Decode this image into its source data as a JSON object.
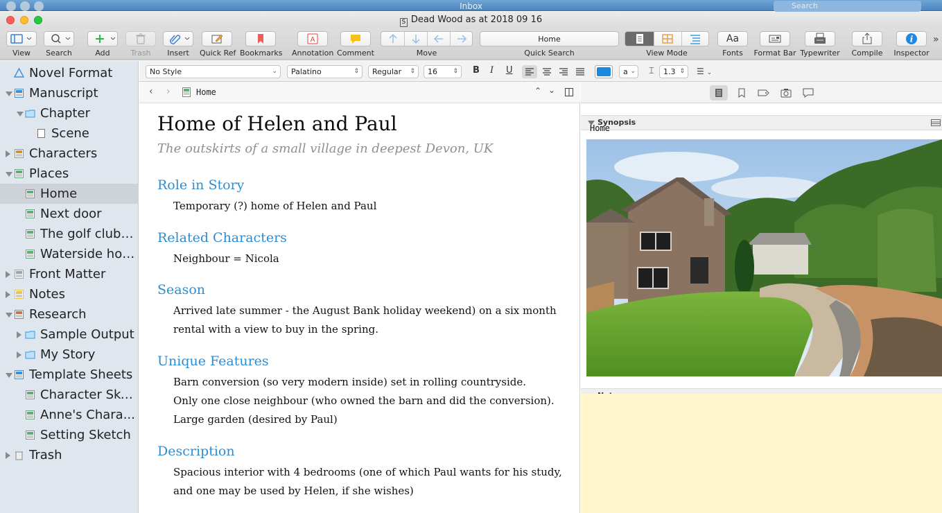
{
  "background_window": {
    "title": "Inbox",
    "search_placeholder": "Search"
  },
  "window": {
    "title": "Dead Wood as at 2018 09 16"
  },
  "toolbar": {
    "view": "View",
    "search": "Search",
    "add": "Add",
    "trash": "Trash",
    "insert": "Insert",
    "quick_ref": "Quick Ref",
    "bookmarks": "Bookmarks",
    "annotation": "Annotation",
    "comment": "Comment",
    "move": "Move",
    "quick_search_value": "Home",
    "quick_search": "Quick Search",
    "view_mode": "View Mode",
    "fonts": "Fonts",
    "format_bar": "Format Bar",
    "typewriter": "Typewriter",
    "compile": "Compile",
    "inspector": "Inspector"
  },
  "format_bar": {
    "style": "No Style",
    "font": "Palatino",
    "weight": "Regular",
    "size": "16",
    "bold": "B",
    "italic": "I",
    "underline": "U",
    "highlight": "a",
    "line_spacing": "1.3",
    "text_color": "#1a87e0"
  },
  "binder": {
    "items": [
      {
        "label": "Novel Format",
        "disclosure": "none",
        "icon": "novel-format-icon"
      },
      {
        "label": "Manuscript",
        "disclosure": "open",
        "icon": "manuscript-icon"
      },
      {
        "label": "Chapter",
        "disclosure": "open",
        "icon": "folder-icon"
      },
      {
        "label": "Scene",
        "disclosure": "none",
        "icon": "document-icon"
      },
      {
        "label": "Characters",
        "disclosure": "closed",
        "icon": "characters-icon"
      },
      {
        "label": "Places",
        "disclosure": "open",
        "icon": "places-icon"
      },
      {
        "label": "Home",
        "disclosure": "none",
        "icon": "place-sheet-icon"
      },
      {
        "label": "Next door",
        "disclosure": "none",
        "icon": "place-sheet-icon"
      },
      {
        "label": "The golf club:...",
        "disclosure": "none",
        "icon": "place-sheet-icon"
      },
      {
        "label": "Waterside hol...",
        "disclosure": "none",
        "icon": "place-sheet-icon"
      },
      {
        "label": "Front Matter",
        "disclosure": "closed",
        "icon": "front-matter-icon"
      },
      {
        "label": "Notes",
        "disclosure": "closed",
        "icon": "notes-icon"
      },
      {
        "label": "Research",
        "disclosure": "open",
        "icon": "research-icon"
      },
      {
        "label": "Sample Output",
        "disclosure": "closed",
        "icon": "folder-icon"
      },
      {
        "label": "My Story",
        "disclosure": "closed",
        "icon": "folder-icon"
      },
      {
        "label": "Template Sheets",
        "disclosure": "open",
        "icon": "template-sheets-icon"
      },
      {
        "label": "Character Ske...",
        "disclosure": "none",
        "icon": "template-icon"
      },
      {
        "label": "Anne's Chara...",
        "disclosure": "none",
        "icon": "template-icon"
      },
      {
        "label": "Setting Sketch",
        "disclosure": "none",
        "icon": "template-icon"
      },
      {
        "label": "Trash",
        "disclosure": "closed",
        "icon": "trash-icon"
      }
    ],
    "selected": "Home"
  },
  "editor": {
    "header_title": "Home",
    "title": "Home of Helen and Paul",
    "subtitle": "The outskirts of a small village in deepest Devon, UK",
    "sections": [
      {
        "heading": "Role in Story",
        "lines": [
          "Temporary (?) home of Helen and Paul"
        ]
      },
      {
        "heading": "Related Characters",
        "lines": [
          "Neighbour = Nicola"
        ]
      },
      {
        "heading": "Season",
        "lines": [
          "Arrived late summer - the August Bank holiday weekend) on a six month",
          "rental with a view to buy in the spring."
        ]
      },
      {
        "heading": "Unique Features",
        "lines": [
          "Barn conversion (so very modern inside) set in rolling countryside.",
          "Only one close neighbour (who owned the barn and did the conversion).",
          "Large garden (desired by Paul)"
        ]
      },
      {
        "heading": "Description",
        "lines": [
          "Spacious interior with 4 bedrooms (one of which Paul wants for his study,",
          "and one may be used by Helen, if she wishes)"
        ]
      }
    ]
  },
  "inspector": {
    "synopsis_label": "Synopsis",
    "synopsis_text": "Home",
    "notes_label": "Notes"
  }
}
